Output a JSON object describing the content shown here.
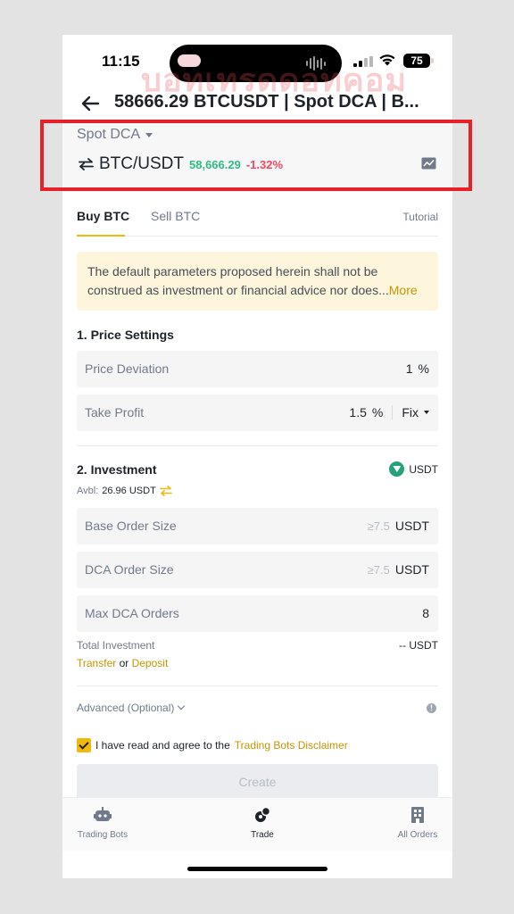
{
  "status_bar": {
    "time": "11:15",
    "battery": "75"
  },
  "header": {
    "title": "58666.29 BTCUSDT | Spot DCA | B..."
  },
  "strategy": {
    "selector": "Spot DCA",
    "pair": "BTC/USDT",
    "price": "58,666.29",
    "change": "-1.32%"
  },
  "tabs": {
    "buy": "Buy BTC",
    "sell": "Sell BTC",
    "tutorial": "Tutorial"
  },
  "notice": {
    "line1": "The default parameters proposed herein shall not be",
    "line2": "construed as investment or financial advice nor does...",
    "more": "More"
  },
  "price_settings": {
    "title": "1. Price Settings",
    "price_deviation": {
      "label": "Price Deviation",
      "value": "1",
      "unit": "%"
    },
    "take_profit": {
      "label": "Take Profit",
      "value": "1.5",
      "unit": "%",
      "mode": "Fix"
    }
  },
  "investment": {
    "title": "2. Investment",
    "currency": "USDT",
    "avbl_label": "Avbl:",
    "avbl_value": "26.96 USDT",
    "base_order": {
      "label": "Base Order Size",
      "hint": "≥7.5",
      "unit": "USDT"
    },
    "dca_order": {
      "label": "DCA Order Size",
      "hint": "≥7.5",
      "unit": "USDT"
    },
    "max_orders": {
      "label": "Max DCA Orders",
      "value": "8"
    },
    "total_label": "Total Investment",
    "total_value": "-- USDT",
    "transfer": "Transfer",
    "or": "or",
    "deposit": "Deposit"
  },
  "advanced": {
    "label": "Advanced (Optional)"
  },
  "agreement": {
    "text": "I have read and agree to the",
    "link": "Trading Bots Disclaimer"
  },
  "create_button": "Create",
  "bottom_nav": {
    "bots": "Trading Bots",
    "trade": "Trade",
    "orders": "All Orders"
  },
  "colors": {
    "accent": "#f0b90b",
    "up": "#2ebd85",
    "down": "#f6465d",
    "highlight": "#e8202a"
  }
}
